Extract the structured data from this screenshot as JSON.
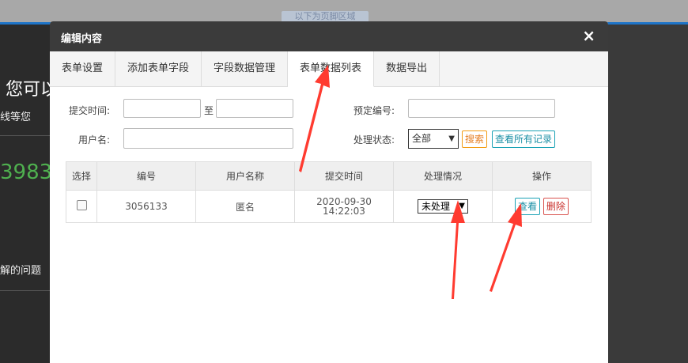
{
  "background": {
    "top_hint": "以下为页脚区域",
    "heading": "您可以",
    "subtext": "线等您",
    "number": "3983",
    "issue_text": "解的问题"
  },
  "dialog": {
    "title": "编辑内容",
    "close_icon": "×"
  },
  "tabs": [
    {
      "label": "表单设置"
    },
    {
      "label": "添加表单字段"
    },
    {
      "label": "字段数据管理"
    },
    {
      "label": "表单数据列表",
      "active": true
    },
    {
      "label": "数据导出"
    }
  ],
  "filters": {
    "submit_time_label": "提交时间:",
    "to_label": "至",
    "reserve_no_label": "预定编号:",
    "username_label": "用户名:",
    "status_label": "处理状态:",
    "status_value": "全部",
    "search_button": "搜索",
    "view_all_button": "查看所有记录"
  },
  "table": {
    "headers": [
      "选择",
      "编号",
      "用户名称",
      "提交时间",
      "处理情况",
      "操作"
    ],
    "rows": [
      {
        "id": "3056133",
        "username": "匿名",
        "submit_date": "2020-09-30",
        "submit_time": "14:22:03",
        "status": "未处理",
        "view_button": "查看",
        "delete_button": "删除"
      }
    ]
  },
  "colors": {
    "header_bg": "#3b3b3b",
    "arrow": "#ff3b30",
    "orange": "#f39c12",
    "teal": "#1aa2b5",
    "red": "#d9534f"
  }
}
